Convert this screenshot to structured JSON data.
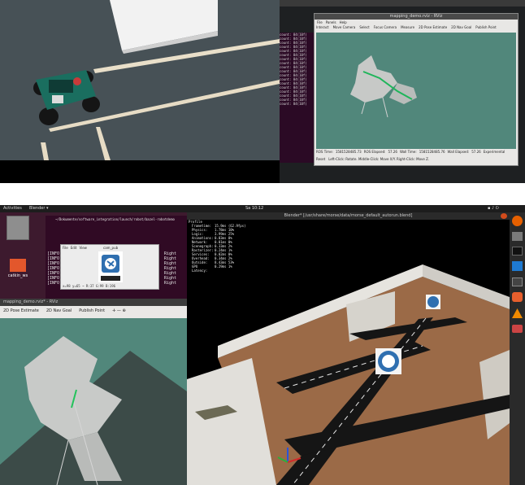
{
  "top_screen": {
    "window_title": "mapping_demo.rviz - RViz",
    "menu": [
      "File",
      "Panels",
      "Help"
    ],
    "tools": [
      "Interact",
      "Move Camera",
      "Select",
      "Focus Camera",
      "Measure",
      "2D Pose Estimate",
      "2D Nav Goal",
      "Publish Point"
    ],
    "status": {
      "ros_time_label": "ROS Time:",
      "ros_time": "1581528485.73",
      "ros_elapsed_label": "ROS Elapsed:",
      "ros_elapsed": "57.26",
      "wall_time_label": "Wall Time:",
      "wall_time": "1581528485.76",
      "wall_elapsed_label": "Wall Elapsed:",
      "wall_elapsed": "57.26",
      "reset": "Reset",
      "experimental": "Experimental",
      "hint": "Left-Click: Rotate. Middle-Click: Move X/Y. Right-Click: Move Z."
    },
    "terminal_lines": [
      "count: 84(10f)",
      "count: 84(10f)",
      "count: 84(10f)",
      "count: 84(10f)",
      "count: 84(10f)",
      "count: 84(10f)",
      "count: 84(10f)",
      "count: 84(10f)",
      "count: 84(10f)",
      "count: 84(10f)",
      "count: 84(10f)",
      "count: 84(10f)",
      "count: 84(10f)",
      "count: 84(10f)",
      "count: 84(10f)",
      "count: 84(10f)",
      "count: 84(10f)",
      "count: 84(10f)"
    ]
  },
  "topbar": {
    "activities": "Activities",
    "app_menu": "Blender ▾",
    "clock": "Sa 10:12"
  },
  "desktop": {
    "icon1_label": "",
    "icon2_label": "catkin_ws",
    "icon3_label": ""
  },
  "terminal_bg": {
    "path": "~/Dokumente/software_integration/launch/robot/bazel-robotdemo",
    "lines": [
      "[INFO]",
      "[INFO]",
      "[INFO]",
      "[INFO]",
      "[INFO]",
      "[INFO]",
      "[INFO]"
    ],
    "right_lines": [
      "Right",
      "Right",
      "Right",
      "Right",
      "Right",
      "Right",
      "Right"
    ],
    "coords": "x=98 y=65 ~ R:37 G:99 B:196"
  },
  "image_viewer": {
    "menu": [
      "File",
      "Edit",
      "View"
    ],
    "title": "cam_pub"
  },
  "rviz_small": {
    "title": "mapping_demo.rviz* - RViz",
    "tools": [
      "2D Pose Estimate",
      "2D Nav Goal",
      "Publish Point"
    ]
  },
  "blender": {
    "title": "Blender* [/usr/share/morse/data/morse_default_autorun.blend]",
    "profile_title": "Profile",
    "profile": [
      {
        "name": "Frametime:",
        "value": "15.9ms (62.9fps)"
      },
      {
        "name": "Physics:",
        "value": "1.78ms   10%"
      },
      {
        "name": "Logic:",
        "value": "3.99ms   25%"
      },
      {
        "name": "Animations:",
        "value": "0.03ms    0%"
      },
      {
        "name": "Network:",
        "value": "0.01ms    0%"
      },
      {
        "name": "Scenegraph:",
        "value": "0.33ms    2%"
      },
      {
        "name": "Rasterizer:",
        "value": "0.24ms    1%"
      },
      {
        "name": "Services:",
        "value": "0.02ms    0%"
      },
      {
        "name": "Overhead:",
        "value": "0.34ms    2%"
      },
      {
        "name": "Outside:",
        "value": "8.43ms   53%"
      },
      {
        "name": "GPU Latency:",
        "value": "0.29ms    1%"
      }
    ]
  },
  "dock": [
    "firefox-icon",
    "files-icon",
    "terminal-icon",
    "vscode-icon",
    "text-editor-icon",
    "ubuntu-software-icon",
    "vlc-icon",
    "drive-icon"
  ],
  "colors": {
    "gl_bg": "#2f6b5a",
    "rviz_map_bg": "#51877b",
    "floor": "#9b6a47",
    "road": "#151515",
    "wall": "#d9d7d2",
    "ubuntu_bar": "#222222"
  }
}
